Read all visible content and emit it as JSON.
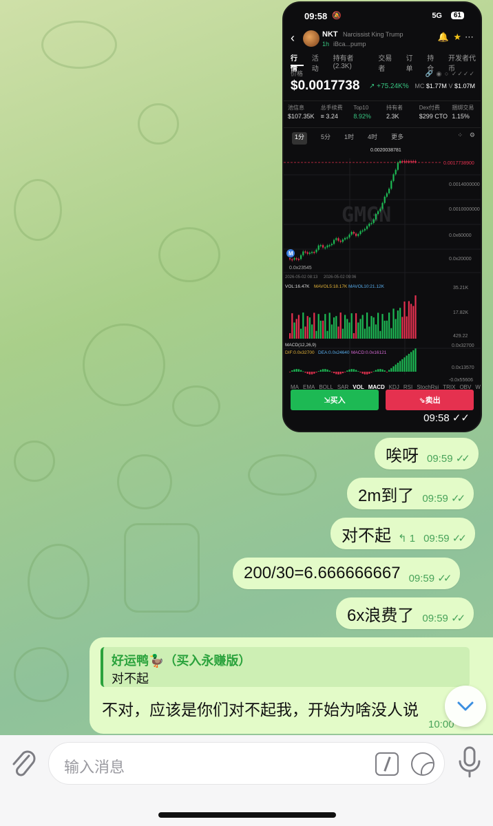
{
  "colors": {
    "bubble": "#e3fbc8",
    "accent_green": "#48a35a",
    "buy": "#1db954",
    "sell": "#e5314f"
  },
  "screenshot": {
    "status_time": "09:58",
    "network": "5G",
    "battery": "61",
    "token": {
      "symbol": "NKT",
      "name": "Narcissist King Trump",
      "age": "1h",
      "address": "iBca...pump"
    },
    "tabs": [
      "行情",
      "活动",
      "持有者(2.3K)",
      "交易者",
      "订单",
      "持仓",
      "开发者代币"
    ],
    "price_label": "价格",
    "price": "$0.0017738",
    "change": "+75.24K%",
    "mc_label": "MC",
    "mc": "$1.77M",
    "vol_label": "V",
    "vol": "$1.07M",
    "stats": [
      {
        "label": "池信息",
        "value": "$107.35K"
      },
      {
        "label": "总手续费",
        "value": "≡ 3.24"
      },
      {
        "label": "Top10",
        "value": "8.92%"
      },
      {
        "label": "持有者",
        "value": "2.3K"
      },
      {
        "label": "Dex付费",
        "value": "$299 CTO"
      },
      {
        "label": "捆绑交易",
        "value": "1.15%"
      }
    ],
    "timeframes": [
      "1分",
      "5分",
      "1时",
      "4时",
      "更多"
    ],
    "chart": {
      "high_label": "0.0020038781",
      "current_label": "0.0017738900",
      "low_label": "0.0x23545",
      "y_ticks": [
        "0.0014000000",
        "0.0010000000",
        "0.0x60000",
        "0.0x20000"
      ],
      "date_left": "2026-05-02 08:13",
      "date_right": "2026-05-02 09:06",
      "vol_text": "VOL:16.47K",
      "mavol5_text": "MAVOL5:18.17K",
      "mavol10_text": "MAVOL10:21.12K",
      "vol_max": "35.21K",
      "vol_mid": "17.82K",
      "vol_min": "429.22",
      "macd_text": "MACD(12,26,9)",
      "dif_text": "DIF:0.0x32700",
      "dea_text": "DEA:0.0x24640",
      "macd_val_text": "MACD:0.0x16121",
      "macd_max": "0.0x32700",
      "macd_mid": "0.0x13570",
      "macd_min": "-0.0x55606",
      "watermark": "GMGN",
      "marker": "M"
    },
    "indicators": [
      "MA",
      "EMA",
      "BOLL",
      "SAR",
      "VOL",
      "MACD",
      "KDJ",
      "RSI",
      "StochRsi",
      "TRIX",
      "OBV",
      "WR"
    ],
    "buy_label": "买入",
    "sell_label": "卖出",
    "timestamp": "09:58"
  },
  "messages": [
    {
      "text": "唉呀",
      "time": "09:59"
    },
    {
      "text": "2m到了",
      "time": "09:59"
    },
    {
      "text": "对不起",
      "time": "09:59",
      "replies": "1"
    },
    {
      "text": "200/30=6.666666667",
      "time": "09:59"
    },
    {
      "text": "6x浪费了",
      "time": "09:59"
    }
  ],
  "reply_message": {
    "quote_name": "好运鸭🦆（买入永赚版）",
    "quote_text": "对不起",
    "text": "不对，应该是你们对不起我，开始为啥没人说",
    "time": "10:00"
  },
  "composer": {
    "placeholder": "输入消息"
  },
  "icons": [
    "attach-icon",
    "command-icon",
    "sticker-icon",
    "mic-icon",
    "chevron-down-icon",
    "double-check-icon",
    "reply-icon"
  ]
}
